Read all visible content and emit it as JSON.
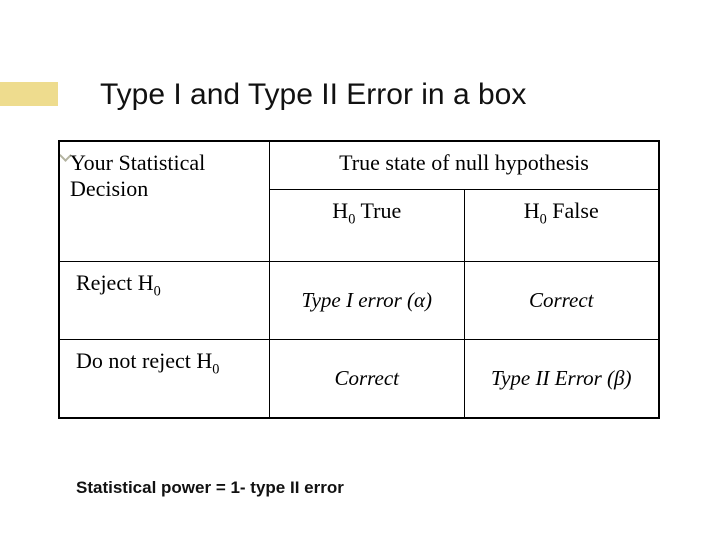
{
  "title": "Type I and Type II Error in a box",
  "table": {
    "header_left_line1": "Your Statistical",
    "header_left_line2": "Decision",
    "header_right": "True state of null hypothesis",
    "col1_prefix": "H",
    "col1_sub": "0",
    "col1_suffix": " True",
    "col2_prefix": "H",
    "col2_sub": "0",
    "col2_suffix": " False",
    "row1_prefix": "Reject H",
    "row1_sub": "0",
    "row2_prefix": "Do not reject H",
    "row2_sub": "0",
    "cell_11": "Type I error (α)",
    "cell_12": "Correct",
    "cell_21": "Correct",
    "cell_22": "Type II Error (β)"
  },
  "footer": "Statistical power = 1- type II error"
}
